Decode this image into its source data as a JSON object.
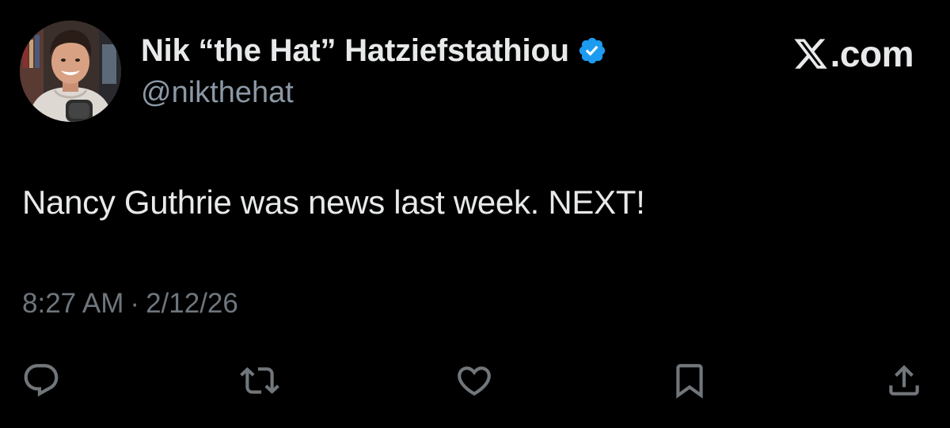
{
  "author": {
    "display_name": "Nik “the Hat” Hatziefstathiou",
    "handle": "@nikthehat",
    "verified": true,
    "verified_color": "#1d9bf0"
  },
  "brand": {
    "icon": "x-logo-icon",
    "text": ".com"
  },
  "tweet": {
    "text": "Nancy Guthrie was news last week. NEXT!",
    "time": "8:27 AM",
    "separator": "·",
    "date": "2/12/26"
  },
  "actions": [
    {
      "icon": "reply-icon"
    },
    {
      "icon": "retweet-icon"
    },
    {
      "icon": "like-heart-icon"
    },
    {
      "icon": "bookmark-icon"
    },
    {
      "icon": "share-icon"
    }
  ],
  "colors": {
    "background": "#000000",
    "primary_text": "#e7e9ea",
    "secondary_text": "#8b98a5",
    "timestamp_text": "#6e767d",
    "icon_gray": "#71767b"
  }
}
